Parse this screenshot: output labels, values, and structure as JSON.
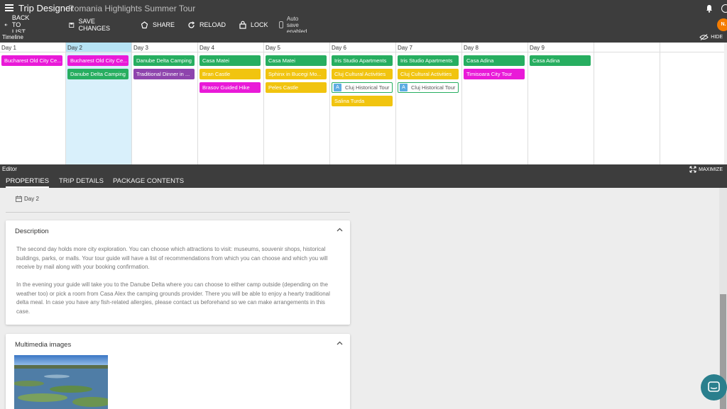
{
  "app": {
    "title": "Trip Designer",
    "trip_name": "Romania Highlights Summer Tour",
    "avatar_initials": "N."
  },
  "toolbar": {
    "back": "BACK TO LIST",
    "save": "SAVE CHANGES",
    "share": "SHARE",
    "reload": "RELOAD",
    "lock": "LOCK",
    "autosave": "Auto save enabled"
  },
  "timeline": {
    "label": "Timeline",
    "hide": "HIDE",
    "selected_day": "Day 2",
    "days": [
      {
        "label": "Day 1",
        "items": [
          {
            "text": "Bucharest Old City Ce...",
            "color": "magenta"
          }
        ]
      },
      {
        "label": "Day 2",
        "items": [
          {
            "text": "Bucharest Old City Ce...",
            "color": "magenta"
          },
          {
            "text": "Danube Delta Camping",
            "color": "green"
          }
        ]
      },
      {
        "label": "Day 3",
        "items": [
          {
            "text": "Danube Delta Camping",
            "color": "green"
          },
          {
            "text": "Traditional Dinner in ...",
            "color": "purple"
          }
        ]
      },
      {
        "label": "Day 4",
        "items": [
          {
            "text": "Casa Matei",
            "color": "green"
          },
          {
            "text": "Bran Castle",
            "color": "yellow"
          },
          {
            "text": "Brasov Guided Hike",
            "color": "magenta"
          }
        ]
      },
      {
        "label": "Day 5",
        "items": [
          {
            "text": "Casa Matei",
            "color": "green"
          },
          {
            "text": "Sphinx in Bucegi Mo...",
            "color": "yellow"
          },
          {
            "text": "Peles Castle",
            "color": "yellow"
          }
        ]
      },
      {
        "label": "Day 6",
        "items": [
          {
            "text": "Iris Studio Apartments",
            "color": "green"
          },
          {
            "text": "Cluj Cultural Activities",
            "color": "yellow"
          },
          {
            "text": "Cluj Historical Tour",
            "color": "outline",
            "badge": "A"
          },
          {
            "text": "Salina Turda",
            "color": "yellow"
          }
        ]
      },
      {
        "label": "Day 7",
        "items": [
          {
            "text": "Iris Studio Apartments",
            "color": "green"
          },
          {
            "text": "Cluj Cultural Activities",
            "color": "yellow"
          },
          {
            "text": "Cluj Historical Tour",
            "color": "outline",
            "badge": "A"
          }
        ]
      },
      {
        "label": "Day 8",
        "items": [
          {
            "text": "Casa Adina",
            "color": "green"
          },
          {
            "text": "Timisoara City Tour",
            "color": "magenta"
          }
        ]
      },
      {
        "label": "Day 9",
        "items": [
          {
            "text": "Casa Adina",
            "color": "green"
          }
        ]
      }
    ]
  },
  "editor": {
    "label": "Editor",
    "maximize": "MAXIMIZE",
    "tabs": [
      "PROPERTIES",
      "TRIP DETAILS",
      "PACKAGE CONTENTS"
    ],
    "active_tab": "PROPERTIES",
    "breadcrumb": "Day 2",
    "description": {
      "title": "Description",
      "paragraphs": [
        "The second day holds more city exploration. You can choose which attractions to visit: museums, souvenir shops, historical buildings, parks, or malls. Your tour guide will have a list of recommendations from which you can choose and which you will receive by mail along with your booking confirmation.",
        "In the evening your guide will take you to the Danube Delta where you can choose to either camp outside (depending on the weather too) or pick a room from Casa Alex the camping grounds provider. There you will be able to enjoy a hearty traditional delta meal. In case you have any fish-related allergies, please contact us beforehand so we can make arrangements in this case."
      ]
    },
    "multimedia": {
      "title": "Multimedia images"
    }
  },
  "colors": {
    "green": "#27ae60",
    "magenta": "#e91ad8",
    "purple": "#8e44ad",
    "yellow": "#f1c40f",
    "header": "#3d3d3d",
    "selected_day": "#d9f0fb"
  }
}
